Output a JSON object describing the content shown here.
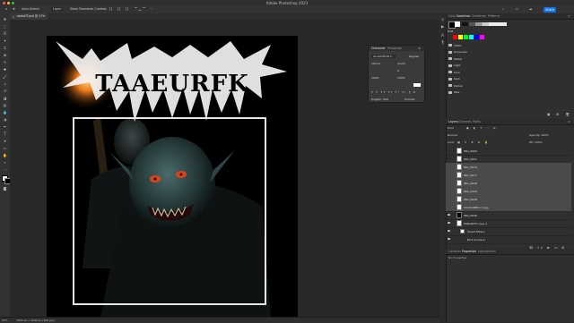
{
  "window": {
    "title": "Adobe Photoshop 2023"
  },
  "options_bar": {
    "auto_select": "Auto-Select:",
    "layer": "Layer",
    "transform": "Show Transform Controls",
    "share": "Share"
  },
  "document": {
    "tab": "rastaHT.psd @ 17% (RGB/8)",
    "logo_text": "TAAEURFK",
    "status_zoom": "25%",
    "status_info": "3000 px x 3000 px (300 ppi)"
  },
  "character_panel": {
    "tabs": [
      "Character",
      "Paragraph"
    ],
    "font": "GLAGHIFON T...",
    "style": "Regular",
    "size": "100 pt",
    "leading": "(Auto)",
    "tracking": "0",
    "scale": "100%",
    "language": "English: USA",
    "aa": "Smooth"
  },
  "swatches_panel": {
    "tabs": [
      "Color",
      "Swatches",
      "Gradients",
      "Patterns"
    ],
    "group_label": "RGB",
    "folders": [
      "CMYK",
      "Grayscale",
      "Pastel",
      "Light",
      "Pure",
      "Dark",
      "Darker",
      "Pale"
    ],
    "colors": [
      "#ff0000",
      "#ffff00",
      "#00ff00",
      "#00ffff",
      "#0000ff",
      "#ff00ff"
    ]
  },
  "layers_panel": {
    "tabs": [
      "Layers",
      "Channels",
      "Paths"
    ],
    "kind": "Kind",
    "blend_mode": "Normal",
    "opacity": "Opacity: 100%",
    "lock": "Lock:",
    "fill": "Fill: 100%",
    "layers": [
      {
        "name": "IMG_9963",
        "selected": false
      },
      {
        "name": "IMG_9951",
        "selected": false
      },
      {
        "name": "IMG_9974",
        "selected": true
      },
      {
        "name": "IMG_9977",
        "selected": true
      },
      {
        "name": "IMG_9928",
        "selected": true
      },
      {
        "name": "IMG_9330",
        "selected": true
      },
      {
        "name": "IMG_9938",
        "selected": true
      },
      {
        "name": "COLOURED 2 copy",
        "selected": true
      },
      {
        "name": "IMG_0836",
        "selected": false
      },
      {
        "name": "TAELURFK copy 2",
        "selected": false
      },
      {
        "name": "Smart Filters",
        "selected": false
      },
      {
        "name": "Find Conde 2",
        "selected": false
      }
    ]
  },
  "libraries_panel": {
    "tabs": [
      "Libraries",
      "Properties",
      "Adjustments"
    ],
    "message": "No Properties"
  }
}
